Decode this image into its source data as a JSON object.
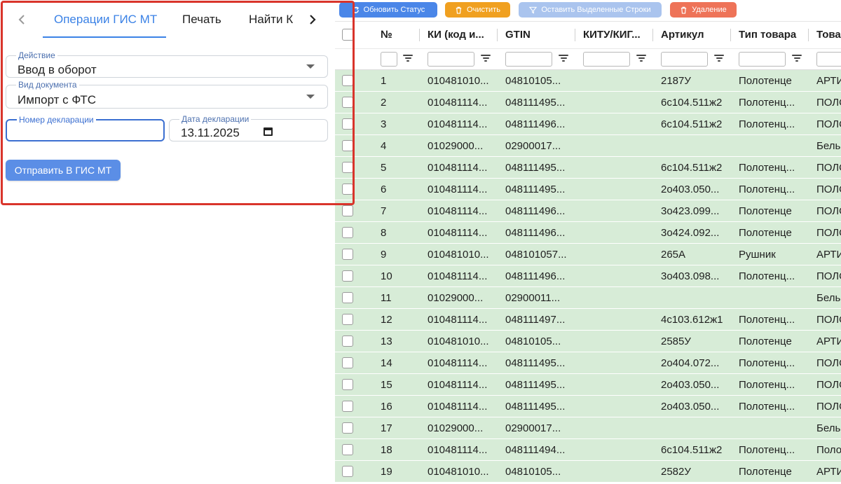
{
  "tabs": {
    "items": [
      "Операции ГИС МТ",
      "Печать",
      "Найти К"
    ],
    "active": "Операции ГИС МТ"
  },
  "form": {
    "action_label": "Действие",
    "action_value": "Ввод в оборот",
    "doc_type_label": "Вид документа",
    "doc_type_value": "Импорт с ФТС",
    "decl_number_label": "Номер декларации",
    "decl_number_value": "",
    "decl_date_label": "Дата декларации",
    "decl_date_value": "13.11.2025",
    "submit_label": "Отправить В ГИС МТ"
  },
  "toolbar": {
    "refresh_label": "Обновить Статус",
    "clear_label": "Очистить",
    "keep_label": "Оставить Выделенные Строки",
    "delete_label": "Удаление"
  },
  "colors": {
    "accent": "#3b82e6",
    "row_bg": "#d7ecd7",
    "highlight": "#d9342b",
    "refresh": "#4a86e8",
    "clear": "#f0a020",
    "keep": "#aac4ee",
    "delete": "#ee7358"
  },
  "grid": {
    "columns": [
      "№",
      "КИ (код и...",
      "GTIN",
      "КИТУ/КИГ...",
      "Артикул",
      "Тип товара",
      "Това"
    ],
    "rows": [
      {
        "num": "1",
        "ki": "010481010...",
        "gtin": "04810105...",
        "kitu": "",
        "art": "2187У",
        "type": "Полотенце",
        "tov": "АРТИ"
      },
      {
        "num": "2",
        "ki": "010481114...",
        "gtin": "048111495...",
        "kitu": "",
        "art": "6с104.511ж2",
        "type": "Полотенц...",
        "tov": "ПОЛО"
      },
      {
        "num": "3",
        "ki": "010481114...",
        "gtin": "048111496...",
        "kitu": "",
        "art": "6с104.511ж2",
        "type": "Полотенц...",
        "tov": "ПОЛО"
      },
      {
        "num": "4",
        "ki": "01029000...",
        "gtin": "02900017...",
        "kitu": "",
        "art": "",
        "type": "",
        "tov": "Бель"
      },
      {
        "num": "5",
        "ki": "010481114...",
        "gtin": "048111495...",
        "kitu": "",
        "art": "6с104.511ж2",
        "type": "Полотенц...",
        "tov": "ПОЛО"
      },
      {
        "num": "6",
        "ki": "010481114...",
        "gtin": "048111495...",
        "kitu": "",
        "art": "2о403.050...",
        "type": "Полотенц...",
        "tov": "ПОЛО"
      },
      {
        "num": "7",
        "ki": "010481114...",
        "gtin": "048111496...",
        "kitu": "",
        "art": "3о423.099...",
        "type": "Полотенце",
        "tov": "ПОЛО"
      },
      {
        "num": "8",
        "ki": "010481114...",
        "gtin": "048111496...",
        "kitu": "",
        "art": "3о424.092...",
        "type": "Полотенце",
        "tov": "ПОЛО"
      },
      {
        "num": "9",
        "ki": "010481010...",
        "gtin": "048101057...",
        "kitu": "",
        "art": "265А",
        "type": "Рушник",
        "tov": "АРТИ"
      },
      {
        "num": "10",
        "ki": "010481114...",
        "gtin": "048111496...",
        "kitu": "",
        "art": "3о403.098...",
        "type": "Полотенц...",
        "tov": "ПОЛО"
      },
      {
        "num": "11",
        "ki": "01029000...",
        "gtin": "02900011...",
        "kitu": "",
        "art": "",
        "type": "",
        "tov": "Бель"
      },
      {
        "num": "12",
        "ki": "010481114...",
        "gtin": "048111497...",
        "kitu": "",
        "art": "4с103.612ж1",
        "type": "Полотенц...",
        "tov": "ПОЛО"
      },
      {
        "num": "13",
        "ki": "010481010...",
        "gtin": "04810105...",
        "kitu": "",
        "art": "2585У",
        "type": "Полотенце",
        "tov": "АРТИ"
      },
      {
        "num": "14",
        "ki": "010481114...",
        "gtin": "048111495...",
        "kitu": "",
        "art": "2о404.072...",
        "type": "Полотенц...",
        "tov": "ПОЛО"
      },
      {
        "num": "15",
        "ki": "010481114...",
        "gtin": "048111495...",
        "kitu": "",
        "art": "2о403.050...",
        "type": "Полотенц...",
        "tov": "ПОЛО"
      },
      {
        "num": "16",
        "ki": "010481114...",
        "gtin": "048111495...",
        "kitu": "",
        "art": "2о403.050...",
        "type": "Полотенц...",
        "tov": "ПОЛО"
      },
      {
        "num": "17",
        "ki": "01029000...",
        "gtin": "02900017...",
        "kitu": "",
        "art": "",
        "type": "",
        "tov": "Бель"
      },
      {
        "num": "18",
        "ki": "010481114...",
        "gtin": "048111494...",
        "kitu": "",
        "art": "6с104.511ж2",
        "type": "Полотенц...",
        "tov": "Поло"
      },
      {
        "num": "19",
        "ki": "010481010...",
        "gtin": "04810105...",
        "kitu": "",
        "art": "2582У",
        "type": "Полотенце",
        "tov": "АРТИ"
      }
    ]
  }
}
